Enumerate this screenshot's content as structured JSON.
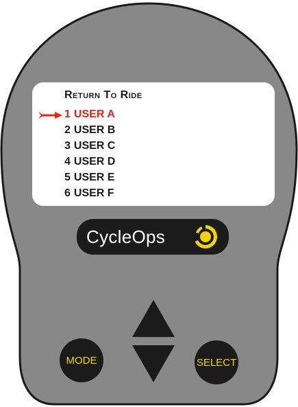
{
  "screen": {
    "title": "Return To Ride",
    "items": [
      {
        "number": "1",
        "label": "USER A",
        "selected": true
      },
      {
        "number": "2",
        "label": "USER B",
        "selected": false
      },
      {
        "number": "3",
        "label": "USER C",
        "selected": false
      },
      {
        "number": "4",
        "label": "USER D",
        "selected": false
      },
      {
        "number": "5",
        "label": "USER E",
        "selected": false
      },
      {
        "number": "6",
        "label": "USER F",
        "selected": false
      }
    ]
  },
  "logo": {
    "text": "CycleOps"
  },
  "controls": {
    "mode_label": "MODE",
    "select_label": "SELECT",
    "up_icon": "triangle-up-icon",
    "down_icon": "triangle-down-icon"
  },
  "colors": {
    "device_body": "#888888",
    "device_outline": "#1a1a1a",
    "screen_background": "#ffffff",
    "selected_item": "#e8231b",
    "logo_background": "#1b1b1b",
    "logo_accent": "#f2d300",
    "button_label": "#f2d300"
  }
}
